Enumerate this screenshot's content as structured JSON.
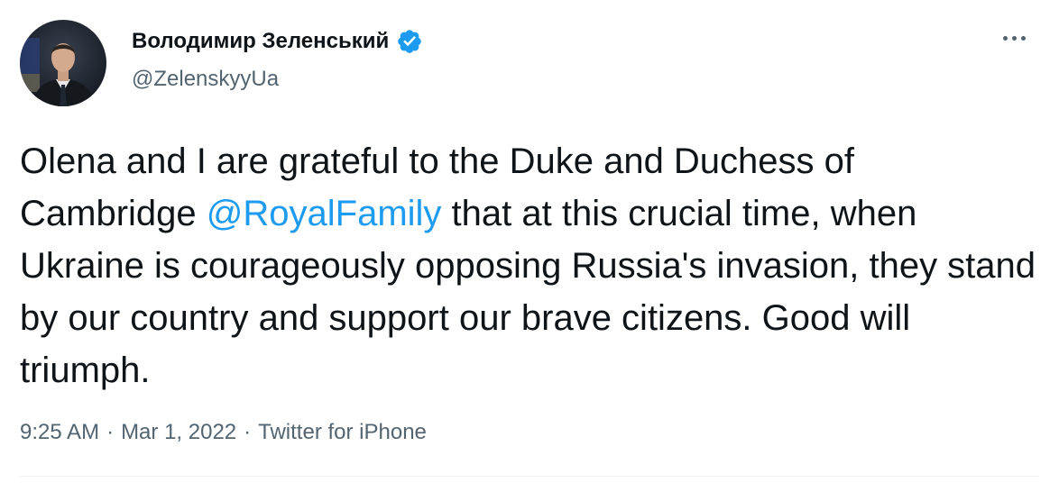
{
  "author": {
    "display_name": "Володимир Зеленський",
    "handle": "@ZelenskyyUa",
    "verified": true,
    "verified_color": "#1d9bf0"
  },
  "tweet": {
    "text_part1": "Olena and I are grateful to the Duke and Duchess of Cambridge ",
    "mention": "@RoyalFamily",
    "text_part2": " that at this crucial time, when Ukraine is courageously opposing Russia's invasion, they stand by our country and support our brave citizens.  Good will triumph."
  },
  "meta": {
    "time": "9:25 AM",
    "separator": "·",
    "date": "Mar 1, 2022",
    "source": "Twitter for iPhone"
  },
  "icons": {
    "more": "more-options-icon",
    "verified": "verified-badge-icon"
  },
  "colors": {
    "text": "#0f1419",
    "secondary": "#536471",
    "link": "#1d9bf0"
  }
}
